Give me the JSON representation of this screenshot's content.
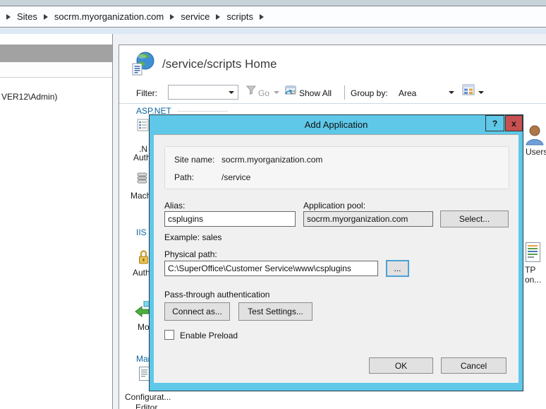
{
  "breadcrumb": {
    "items": [
      "Sites",
      "socrm.myorganization.com",
      "service",
      "scripts"
    ]
  },
  "sidebar": {
    "connection": "VER12\\Admin)"
  },
  "main": {
    "title": "/service/scripts Home",
    "toolbar": {
      "filter_label": "Filter:",
      "go": "Go",
      "show_all": "Show All",
      "group_by_label": "Group by:",
      "group_by_value": "Area"
    },
    "features": {
      "aspnet_section": "ASP.NET",
      "authz_l1": ".N",
      "authz_l2": "Auth",
      "machine_key": "Mach",
      "iis_section": "IIS",
      "authentication": "Auth",
      "modules": "Mo",
      "management_section": "Mar",
      "config_l1": "Configurat...",
      "config_l2": "Editor",
      "users": "Users",
      "http_l1": "TP",
      "http_l2": "on..."
    }
  },
  "dialog": {
    "title": "Add Application",
    "help": "?",
    "close": "x",
    "site_name_label": "Site name:",
    "site_name": "socrm.myorganization.com",
    "path_label": "Path:",
    "path": "/service",
    "alias_label": "Alias:",
    "alias": "csplugins",
    "pool_label": "Application pool:",
    "pool": "socrm.myorganization.com",
    "select": "Select...",
    "example": "Example: sales",
    "physical_path_label": "Physical path:",
    "physical_path": "C:\\SuperOffice\\Customer Service\\www\\csplugins",
    "browse": "...",
    "passthrough": "Pass-through authentication",
    "connect_as": "Connect as...",
    "test_settings": "Test Settings...",
    "enable_preload": "Enable Preload",
    "ok": "OK",
    "cancel": "Cancel"
  },
  "colors": {
    "titlebar": "#5fc8e8",
    "close_button": "#c75050",
    "section_header": "#0b64a0"
  }
}
